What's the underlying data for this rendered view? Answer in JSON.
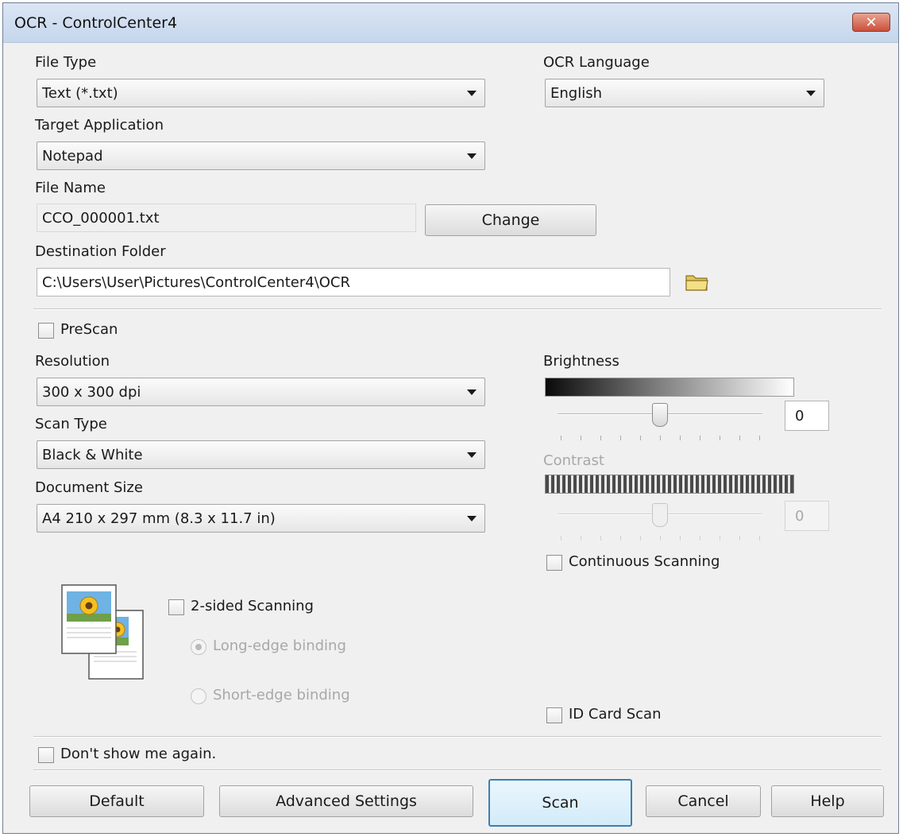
{
  "window": {
    "title": "OCR - ControlCenter4",
    "close_glyph": "✕"
  },
  "file_type": {
    "label": "File Type",
    "value": "Text (*.txt)"
  },
  "ocr_language": {
    "label": "OCR Language",
    "value": "English"
  },
  "target_application": {
    "label": "Target Application",
    "value": "Notepad"
  },
  "file_name": {
    "label": "File Name",
    "value": "CCO_000001.txt",
    "change_button": "Change"
  },
  "destination_folder": {
    "label": "Destination Folder",
    "value": "C:\\Users\\User\\Pictures\\ControlCenter4\\OCR",
    "icon": "folder-icon"
  },
  "prescan": {
    "label": "PreScan",
    "checked": false
  },
  "resolution": {
    "label": "Resolution",
    "value": "300 x 300 dpi"
  },
  "scan_type": {
    "label": "Scan Type",
    "value": "Black & White"
  },
  "document_size": {
    "label": "Document Size",
    "value": "A4 210 x 297 mm (8.3 x 11.7 in)"
  },
  "brightness": {
    "label": "Brightness",
    "value": "0",
    "level": 0.5,
    "enabled": true
  },
  "contrast": {
    "label": "Contrast",
    "value": "0",
    "level": 0.5,
    "enabled": false
  },
  "continuous_scanning": {
    "label": "Continuous Scanning",
    "checked": false
  },
  "two_sided": {
    "label": "2-sided Scanning",
    "checked": false,
    "long_edge": "Long-edge binding",
    "short_edge": "Short-edge binding",
    "selected": "long_edge"
  },
  "id_card_scan": {
    "label": "ID Card Scan",
    "checked": false
  },
  "dont_show": {
    "label": "Don't show me again.",
    "checked": false
  },
  "footer": {
    "default": "Default",
    "advanced": "Advanced Settings",
    "scan": "Scan",
    "cancel": "Cancel",
    "help": "Help"
  },
  "colors": {
    "accent": "#3c7fb1",
    "close": "#c9503a"
  }
}
